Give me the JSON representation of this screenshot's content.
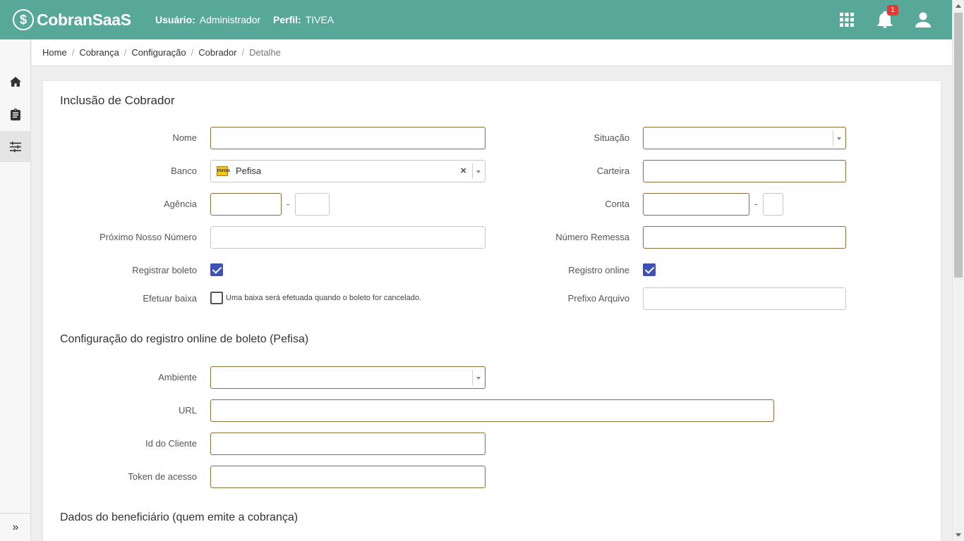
{
  "header": {
    "brand": "CobranSaaS",
    "user_label": "Usuário:",
    "user_value": "Administrador",
    "profile_label": "Perfil:",
    "profile_value": "TIVEA",
    "notifications_count": "1"
  },
  "sidebar": {
    "items": [
      "home-icon",
      "clipboard-icon",
      "sliders-icon"
    ],
    "expand_label": "»"
  },
  "breadcrumb": [
    "Home",
    "Cobrança",
    "Configuração",
    "Cobrador",
    "Detalhe"
  ],
  "form": {
    "title": "Inclusão de Cobrador",
    "nome_label": "Nome",
    "nome_value": "",
    "situacao_label": "Situação",
    "situacao_value": "",
    "banco_label": "Banco",
    "banco_value": "Pefisa",
    "banco_logo_text": "PEFISA",
    "carteira_label": "Carteira",
    "carteira_value": "",
    "agencia_label": "Agência",
    "agencia_value": "",
    "agencia_digito": "",
    "conta_label": "Conta",
    "conta_value": "",
    "conta_digito": "",
    "dash": "-",
    "proximo_label": "Próximo Nosso Número",
    "proximo_value": "",
    "remessa_label": "Número Remessa",
    "remessa_value": "",
    "registrar_label": "Registrar boleto",
    "registrar_checked": true,
    "registro_online_label": "Registro online",
    "registro_online_checked": true,
    "efetuar_baixa_label": "Efetuar baixa",
    "efetuar_baixa_checked": false,
    "efetuar_baixa_hint": "Uma baixa será efetuada quando o boleto for cancelado.",
    "prefixo_label": "Prefixo Arquivo",
    "prefixo_value": ""
  },
  "online": {
    "title": "Configuração do registro online de boleto (Pefisa)",
    "ambiente_label": "Ambiente",
    "ambiente_value": "",
    "url_label": "URL",
    "url_value": "",
    "id_cliente_label": "Id do Cliente",
    "id_cliente_value": "",
    "token_label": "Token de acesso",
    "token_value": ""
  },
  "beneficiario": {
    "title": "Dados do beneficiário (quem emite a cobrança)"
  },
  "colors": {
    "header_bg": "#58a89a",
    "accent_checkbox": "#3f51b5",
    "input_border": "#8a6d3b",
    "badge": "#e53935"
  }
}
